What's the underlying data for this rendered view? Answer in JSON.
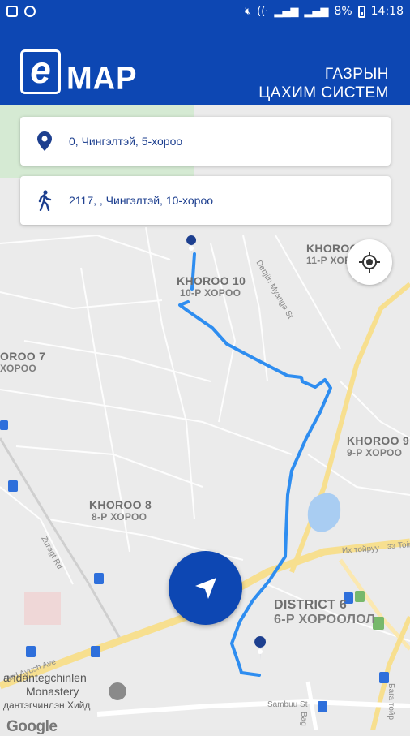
{
  "status_bar": {
    "battery": "8%",
    "time": "14:18"
  },
  "app_bar": {
    "logo_letter": "e",
    "logo_text": "MAP",
    "subtitle_line1": "ГАЗРЫН",
    "subtitle_line2": "ЦАХИМ СИСТЕМ"
  },
  "search": {
    "origin_value": "0, Чингэлтэй, 5-хороо",
    "destination_value": "2117, , Чингэлтэй, 10-хороо"
  },
  "map": {
    "labels": [
      {
        "name": "KHOROO 10",
        "sub": "10-Р ХОРОО"
      },
      {
        "name": "KHOROO",
        "sub": "11-Р ХОР"
      },
      {
        "name": "OROO 7",
        "sub": "ХОРОО"
      },
      {
        "name": "KHOROO 9",
        "sub": "9-Р ХОРОО"
      },
      {
        "name": "KHOROO 8",
        "sub": "8-Р ХОРОО"
      },
      {
        "name": "DISTRICT 6",
        "sub": "6-Р ХОРООЛОЛ"
      }
    ],
    "streets": [
      "Denjiin Myanga St",
      "Zuragt Rd",
      "Их тойруу",
      "ээ Toirui",
      "Ard Ayush Ave",
      "Sambuu St",
      "Бага тойр",
      "Bag"
    ],
    "poi": {
      "line1": "andantegchinlen",
      "line2": "Monastery",
      "line3": "дантэгчинлэн Хийд"
    },
    "attribution": "Google"
  },
  "icons": {
    "origin": "location-pin-icon",
    "destination": "walking-person-icon",
    "locate": "my-location-icon",
    "navigate": "navigation-arrow-icon"
  },
  "colors": {
    "brand": "#0d47b3",
    "route": "#2e8df0",
    "card_text": "#1d3f8f"
  }
}
